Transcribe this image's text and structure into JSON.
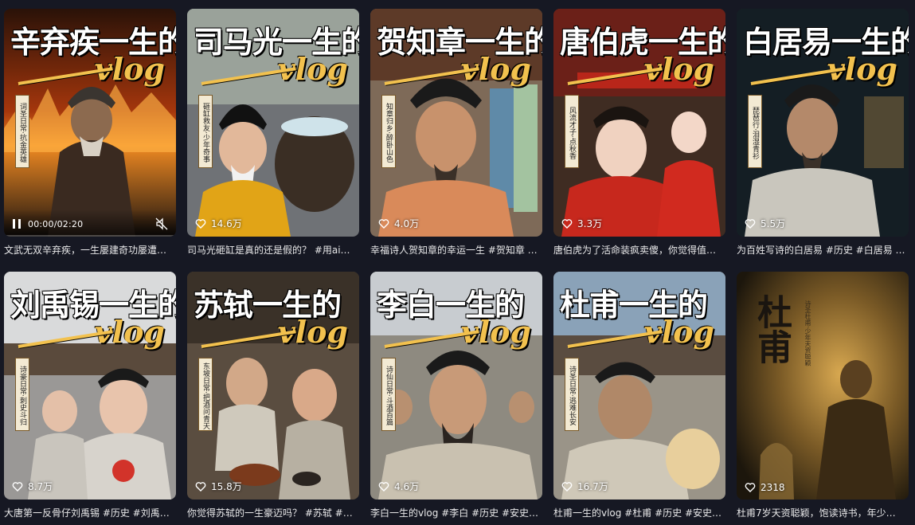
{
  "feed": {
    "items": [
      {
        "title": "辛弃疾一生的",
        "vlog": "vlog",
        "badge": "词圣日常·抗金英雄",
        "theme": "fire",
        "playing": true,
        "time": "00:00/02:20",
        "progress": 0.0,
        "likes": "",
        "description": "文武无双辛弃疾，一生屡建奇功屡遭…"
      },
      {
        "title": "司马光一生的",
        "vlog": "vlog",
        "badge": "砸缸救友·少年奇事",
        "theme": "yellow",
        "likes": "14.6万",
        "description": "司马光砸缸是真的还是假的？ #用ai…"
      },
      {
        "title": "贺知章一生的",
        "vlog": "vlog",
        "badge": "知章归乡·醉卧山色",
        "theme": "street",
        "likes": "4.0万",
        "description": "幸福诗人贺知章的幸运一生 #贺知章 …"
      },
      {
        "title": "唐伯虎一生的",
        "vlog": "vlog",
        "badge": "风流才子·点秋香",
        "theme": "red",
        "likes": "3.3万",
        "description": "唐伯虎为了活命装疯卖傻，你觉得值…"
      },
      {
        "title": "白居易一生的",
        "vlog": "vlog",
        "badge": "琵琶行·泪湿青衫",
        "theme": "night",
        "likes": "5.5万",
        "description": "为百姓写诗的白居易 #历史 #白居易 …"
      },
      {
        "title": "刘禹锡一生的",
        "vlog": "vlog",
        "badge": "诗豪日常·刺史斗归",
        "theme": "gray",
        "likes": "8.7万",
        "description": "大唐第一反骨仔刘禹锡 #历史 #刘禹…"
      },
      {
        "title": "苏轼一生的",
        "vlog": "vlog",
        "badge": "东坡日常·把酒问青天",
        "theme": "feast",
        "likes": "15.8万",
        "description": "你觉得苏轼的一生豪迈吗？ #苏轼 #…"
      },
      {
        "title": "李白一生的",
        "vlog": "vlog",
        "badge": "诗仙日常·斗酒百篇",
        "theme": "crowd",
        "likes": "4.6万",
        "description": "李白一生的vlog #李白 #历史 #安史…"
      },
      {
        "title": "杜甫一生的",
        "vlog": "vlog",
        "badge": "诗圣日常·逃难长安",
        "theme": "city",
        "likes": "16.7万",
        "description": "杜甫一生的vlog #杜甫 #历史 #安史…"
      },
      {
        "title": "杜甫",
        "vlog": "",
        "badge": "诗圣杜甫·少年天资聪颖",
        "theme": "sepia",
        "likes": "2318",
        "description": "杜甫7岁天资聪颖，饱读诗书，年少…"
      }
    ]
  },
  "theme_colors": {
    "fire": [
      "#3a1506",
      "#b7410e",
      "#f28c28"
    ],
    "yellow": [
      "#4e5a62",
      "#6d6a63",
      "#d9a21b"
    ],
    "street": [
      "#6b5a4a",
      "#8f7a66",
      "#d9875a"
    ],
    "red": [
      "#3c2a22",
      "#7a2a1a",
      "#c72c1f"
    ],
    "night": [
      "#0e1a22",
      "#2a3a40",
      "#b9b4a8"
    ],
    "gray": [
      "#8a8a8a",
      "#c5c5c5",
      "#e8e8e8"
    ],
    "feast": [
      "#4a4036",
      "#7a6a58",
      "#c9b49a"
    ],
    "crowd": [
      "#7d8a95",
      "#a8a49a",
      "#c7bca8"
    ],
    "city": [
      "#6a7f95",
      "#9a9a94",
      "#d8cfbd"
    ],
    "sepia": [
      "#2a2012",
      "#6a5024",
      "#b88a3a"
    ]
  },
  "icons": {
    "like": "heart-outline-icon",
    "pause": "pause-icon",
    "mute": "muted-speaker-icon"
  }
}
